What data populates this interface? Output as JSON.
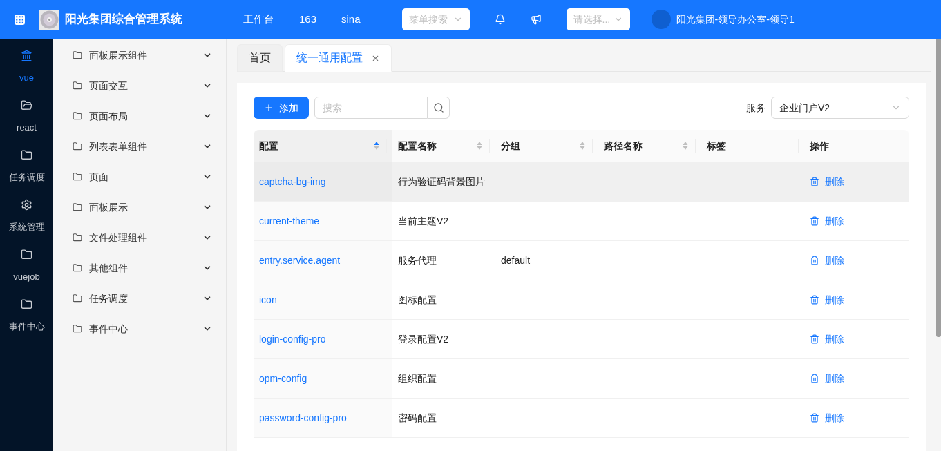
{
  "header": {
    "title": "阳光集团综合管理系统",
    "nav": [
      "工作台",
      "163",
      "sina"
    ],
    "menu_search": {
      "placeholder": "菜单搜索"
    },
    "select": {
      "placeholder": "请选择..."
    },
    "user": "阳光集团-领导办公室-领导1"
  },
  "rail": [
    {
      "label": "vue",
      "kind": "landmark",
      "selected": true
    },
    {
      "label": "react",
      "kind": "folder-open",
      "selected": false
    },
    {
      "label": "任务调度",
      "kind": "folder",
      "selected": false
    },
    {
      "label": "系统管理",
      "kind": "gear",
      "selected": false
    },
    {
      "label": "vuejob",
      "kind": "folder",
      "selected": false
    },
    {
      "label": "事件中心",
      "kind": "folder",
      "selected": false
    }
  ],
  "submenu": [
    "面板展示组件",
    "页面交互",
    "页面布局",
    "列表表单组件",
    "页面",
    "面板展示",
    "文件处理组件",
    "其他组件",
    "任务调度",
    "事件中心"
  ],
  "tabs": [
    {
      "label": "首页",
      "selected": false,
      "closable": false
    },
    {
      "label": "统一通用配置",
      "selected": true,
      "closable": true
    }
  ],
  "toolbar": {
    "add": "添加",
    "search": {
      "placeholder": "搜索"
    },
    "service_label": "服务",
    "service_value": "企业门户V2"
  },
  "table": {
    "columns": [
      {
        "label": "配置",
        "sorted": true
      },
      {
        "label": "配置名称",
        "sorted": false
      },
      {
        "label": "分组",
        "sorted": false
      },
      {
        "label": "路径名称",
        "sorted": false
      },
      {
        "label": "标签"
      },
      {
        "label": "操作"
      }
    ],
    "rows": [
      {
        "key": "captcha-bg-img",
        "name": "行为验证码背景图片",
        "action": "删除",
        "hovered": true
      },
      {
        "key": "current-theme",
        "name": "当前主题V2",
        "action": "删除",
        "hovered": false
      },
      {
        "key": "entry.service.agent",
        "name": "服务代理",
        "group": "default",
        "action": "删除",
        "hovered": false
      },
      {
        "key": "icon",
        "name": "图标配置",
        "action": "删除",
        "hovered": false
      },
      {
        "key": "login-config-pro",
        "name": "登录配置V2",
        "action": "删除",
        "hovered": false
      },
      {
        "key": "opm-config",
        "name": "组织配置",
        "action": "删除",
        "hovered": false
      },
      {
        "key": "password-config-pro",
        "name": "密码配置",
        "action": "删除",
        "hovered": false
      }
    ]
  }
}
